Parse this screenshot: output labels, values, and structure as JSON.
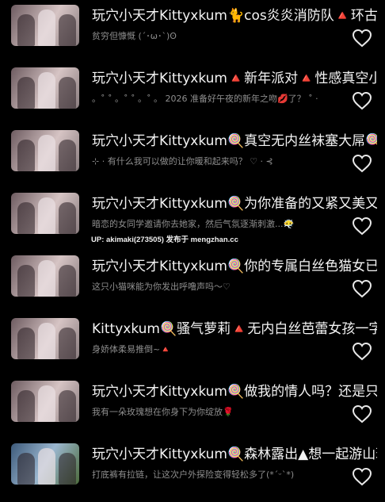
{
  "items": [
    {
      "title": "玩穴小天才Kittyxkum🐈cos炎炎消防队🔺环古达🔺",
      "subtitle": "贫穷但慷慨 (´･ω･`)ʘ"
    },
    {
      "title": "玩穴小天才Kittyxkum🔺新年派对🔺性感真空小洋装",
      "subtitle": "。˚ ˚ 。˚ ˚ 。˚ 。 2026 准备好午夜的新年之吻💋了？ ˚ ·"
    },
    {
      "title": "玩穴小天才Kittyxkum🍭真空无内丝袜塞大屌🍭",
      "subtitle": "⊹ · 有什么我可以做的让你暖和起来吗？ ♡ · ⊰"
    },
    {
      "title": "玩穴小天才Kittyxkum🍭为你准备的又紧又美又湿",
      "subtitle": "暗恋的女同学邀请你去她家，然后气氛逐渐刺激...😶‍🌫️"
    },
    {
      "title": "玩穴小天才Kittyxkum🍭你的专属白丝色猫女已上线",
      "subtitle": "这只小猫咪能为你发出呼噜声吗～♡"
    },
    {
      "title": "Kittyxkum🍭骚气萝莉🔺无内白丝芭蕾女孩一字马",
      "subtitle": "身娇体柔易推倒~🔺"
    },
    {
      "title": "玩穴小天才Kittyxkum🍭做我的情人吗？还是只做我的",
      "subtitle": "我有一朵玫瑰想在你身下为你绽放🌹"
    },
    {
      "title": "玩穴小天才Kittyxkum🍭森林露出▲想一起游山玩水吗",
      "subtitle": "打底裤有拉链，让这次户外探险变得轻松多了(*ˊᵕˋ*)"
    }
  ],
  "watermark": "UP: akimaki(273505) 发布于 mengzhan.cc",
  "icons": {
    "like": "heart-outline-icon"
  }
}
